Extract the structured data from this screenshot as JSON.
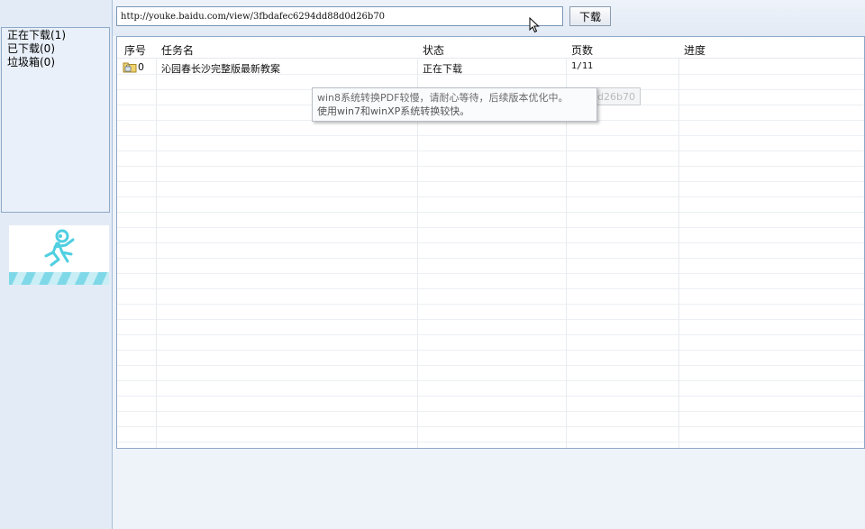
{
  "sidebar": {
    "items": [
      {
        "label": "正在下载(1)"
      },
      {
        "label": "已下载(0)"
      },
      {
        "label": "垃圾箱(0)"
      }
    ]
  },
  "toolbar": {
    "url_value": "http://youke.baidu.com/view/3fbdafec6294dd88d0d26b70",
    "download_label": "下载"
  },
  "table": {
    "headers": {
      "index": "序号",
      "name": "任务名",
      "status": "状态",
      "pages": "页数",
      "progress": "进度"
    },
    "rows": [
      {
        "index": "0",
        "name": "沁园春长沙完整版最新教案",
        "status": "正在下载",
        "pages": "1/11",
        "progress": ""
      }
    ]
  },
  "tooltip": {
    "line1": "win8系统转换PDF较慢，请耐心等待，后续版本优化中。",
    "line2": "使用win7和winXP系统转换较快。",
    "tail": "d26b70"
  },
  "colors": {
    "accent": "#8ea8c8",
    "sidebar_bg": "#e3ebf6",
    "logo_cyan": "#4fcfe0"
  },
  "icons": {
    "row_icon": "folder-lock-icon",
    "logo": "running-figure-icon",
    "cursor": "mouse-pointer-icon"
  }
}
